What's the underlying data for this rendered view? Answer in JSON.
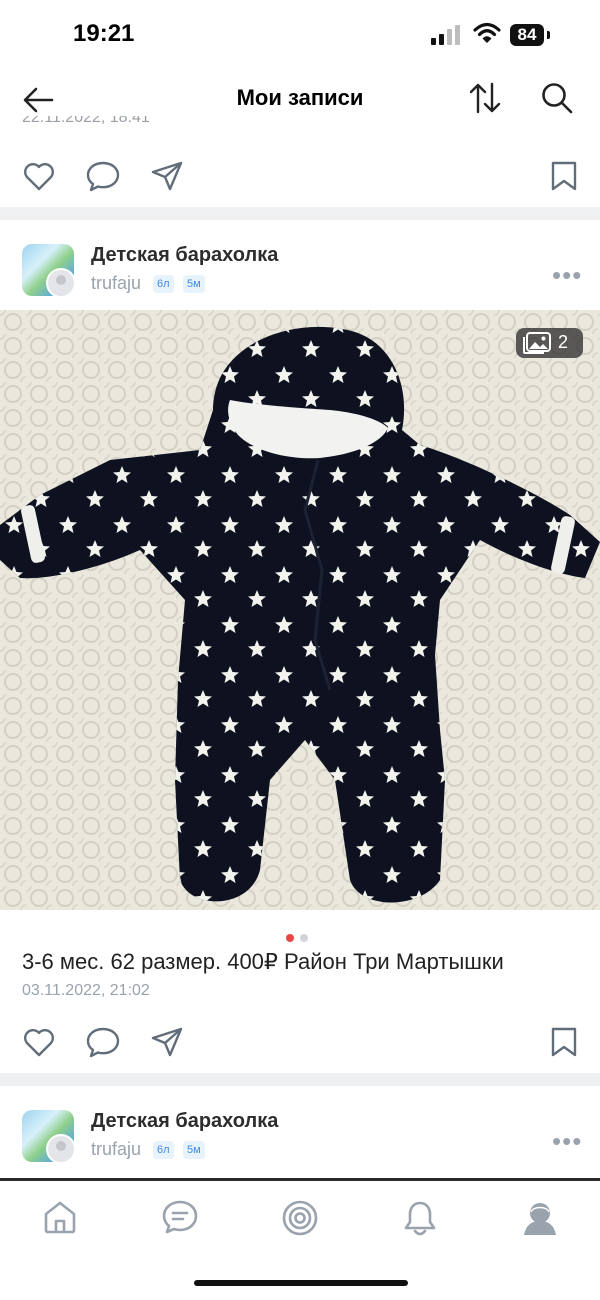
{
  "status_bar": {
    "time": "19:21",
    "battery": "84"
  },
  "header": {
    "title": "Мои записи"
  },
  "previous_post": {
    "date_partial": "22.11.2022, 18:41"
  },
  "posts": [
    {
      "group": "Детская барахолка",
      "author": "trufaju",
      "badges": [
        "6л",
        "5м"
      ],
      "photo_count": "2",
      "carousel": {
        "total": 2,
        "active": 1
      },
      "caption": "3-6 мес. 62 размер. 400₽ Район Три Мартышки",
      "date": "03.11.2022, 21:02"
    },
    {
      "group": "Детская барахолка",
      "author": "trufaju",
      "badges": [
        "6л",
        "5м"
      ]
    }
  ],
  "icons": [
    "back-arrow-icon",
    "sort-icon",
    "search-icon",
    "like-icon",
    "comment-icon",
    "share-icon",
    "bookmark-icon",
    "more-icon",
    "gallery-icon",
    "home-icon",
    "messages-icon",
    "clips-icon",
    "notifications-icon",
    "profile-icon"
  ],
  "colors": {
    "accent": "#3f8ae0",
    "active_dot": "#e64646",
    "badge_bg": "#e6f3fb",
    "muted": "#99a2ad"
  }
}
